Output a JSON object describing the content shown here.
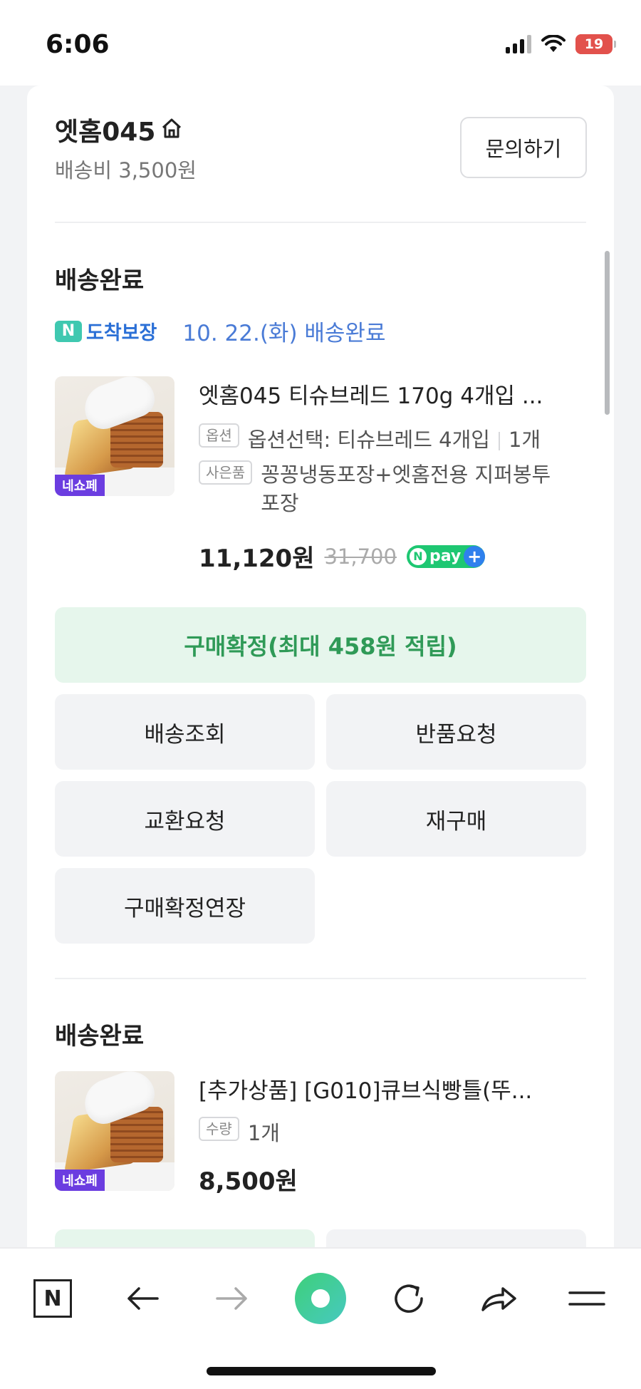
{
  "status_bar": {
    "time": "6:06",
    "battery": "19"
  },
  "store": {
    "name": "엣홈045",
    "shipping_fee": "배송비 3,500원",
    "inquiry_label": "문의하기"
  },
  "order1": {
    "status": "배송완료",
    "arrival_badge_n": "N",
    "arrival_badge": "도착보장",
    "arrival_date": "10. 22.(화) 배송완료",
    "thumb_label": "네쇼페",
    "title": "엣홈045 티슈브레드 170g 4개입 ...",
    "option_tag": "옵션",
    "option_text": "옵션선택: 티슈브레드 4개입",
    "option_qty": "1개",
    "gift_tag": "사은품",
    "gift_text": "꽁꽁냉동포장+엣홈전용 지퍼봉투 포장",
    "price": "11,120원",
    "original_price": "31,700",
    "npay_n": "N",
    "npay_label": "pay",
    "npay_plus": "+",
    "confirm_label": "구매확정(최대 458원 적립)",
    "actions": [
      "배송조회",
      "반품요청",
      "교환요청",
      "재구매",
      "구매확정연장"
    ]
  },
  "order2": {
    "status": "배송완료",
    "thumb_label": "네쇼페",
    "title": "[추가상품] [G010]큐브식빵틀(뚜...",
    "qty_tag": "수량",
    "qty_text": "1개",
    "price": "8,500원"
  },
  "browser_bar": {
    "n_label": "N",
    "back_icon": "arrow-left-icon",
    "forward_icon": "arrow-right-icon",
    "home_icon": "green-dot-icon",
    "refresh_icon": "refresh-icon",
    "share_icon": "share-icon",
    "menu_icon": "menu-icon"
  },
  "colors": {
    "accent_green": "#2f9a57",
    "confirm_bg": "#e6f6ec",
    "date_blue": "#4a7bd6",
    "battery_red": "#e2514c"
  }
}
